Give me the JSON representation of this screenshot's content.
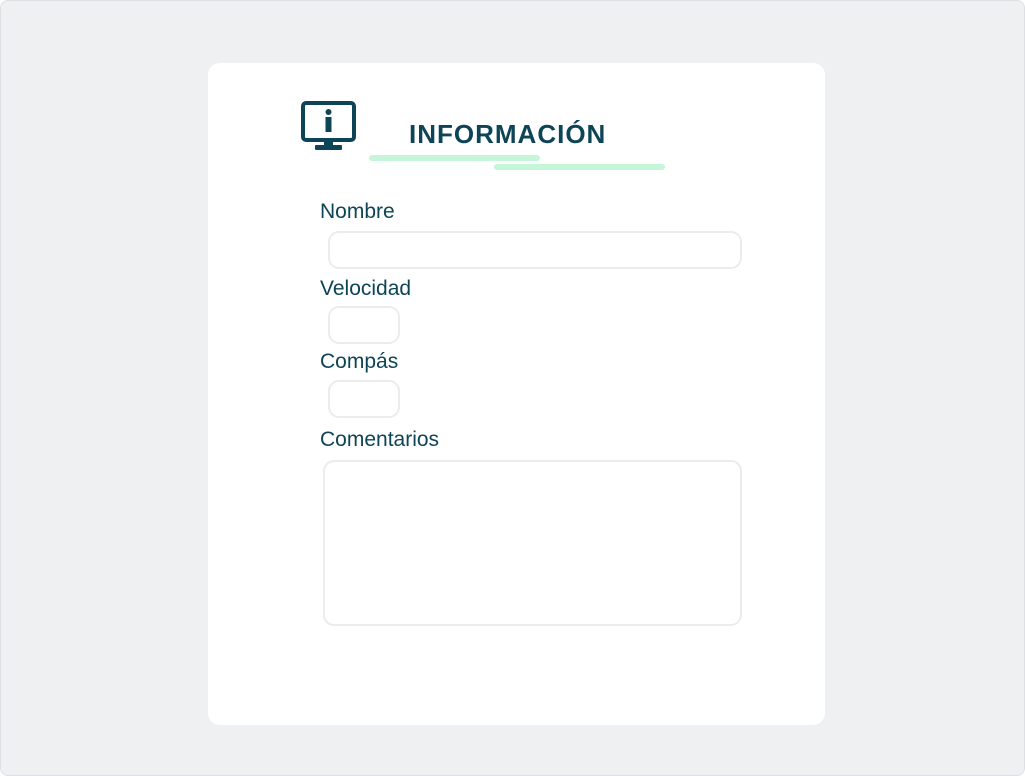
{
  "form": {
    "title": "INFORMACIÓN",
    "icon": "monitor-info-icon",
    "accent_color": "#0e4457",
    "underline_color": "#c5f6d8",
    "fields": {
      "nombre": {
        "label": "Nombre",
        "value": ""
      },
      "velocidad": {
        "label": "Velocidad",
        "value": ""
      },
      "compas": {
        "label": "Compás",
        "value": ""
      },
      "comentarios": {
        "label": "Comentarios",
        "value": ""
      }
    }
  }
}
